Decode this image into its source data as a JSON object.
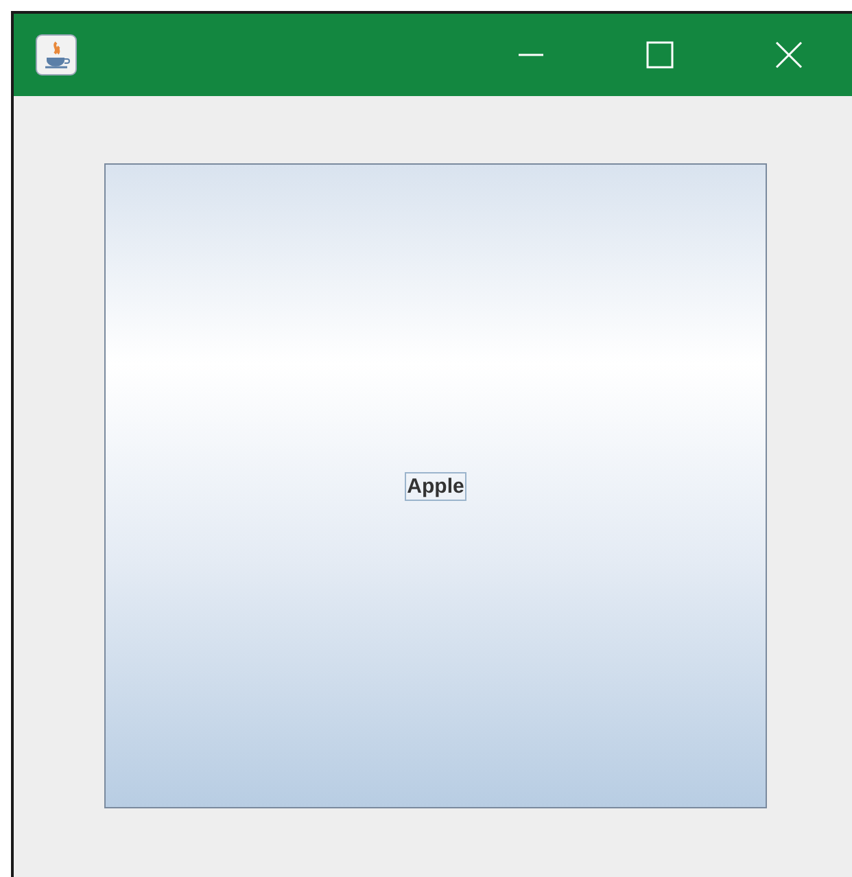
{
  "button": {
    "label": "Apple",
    "focused": true
  }
}
